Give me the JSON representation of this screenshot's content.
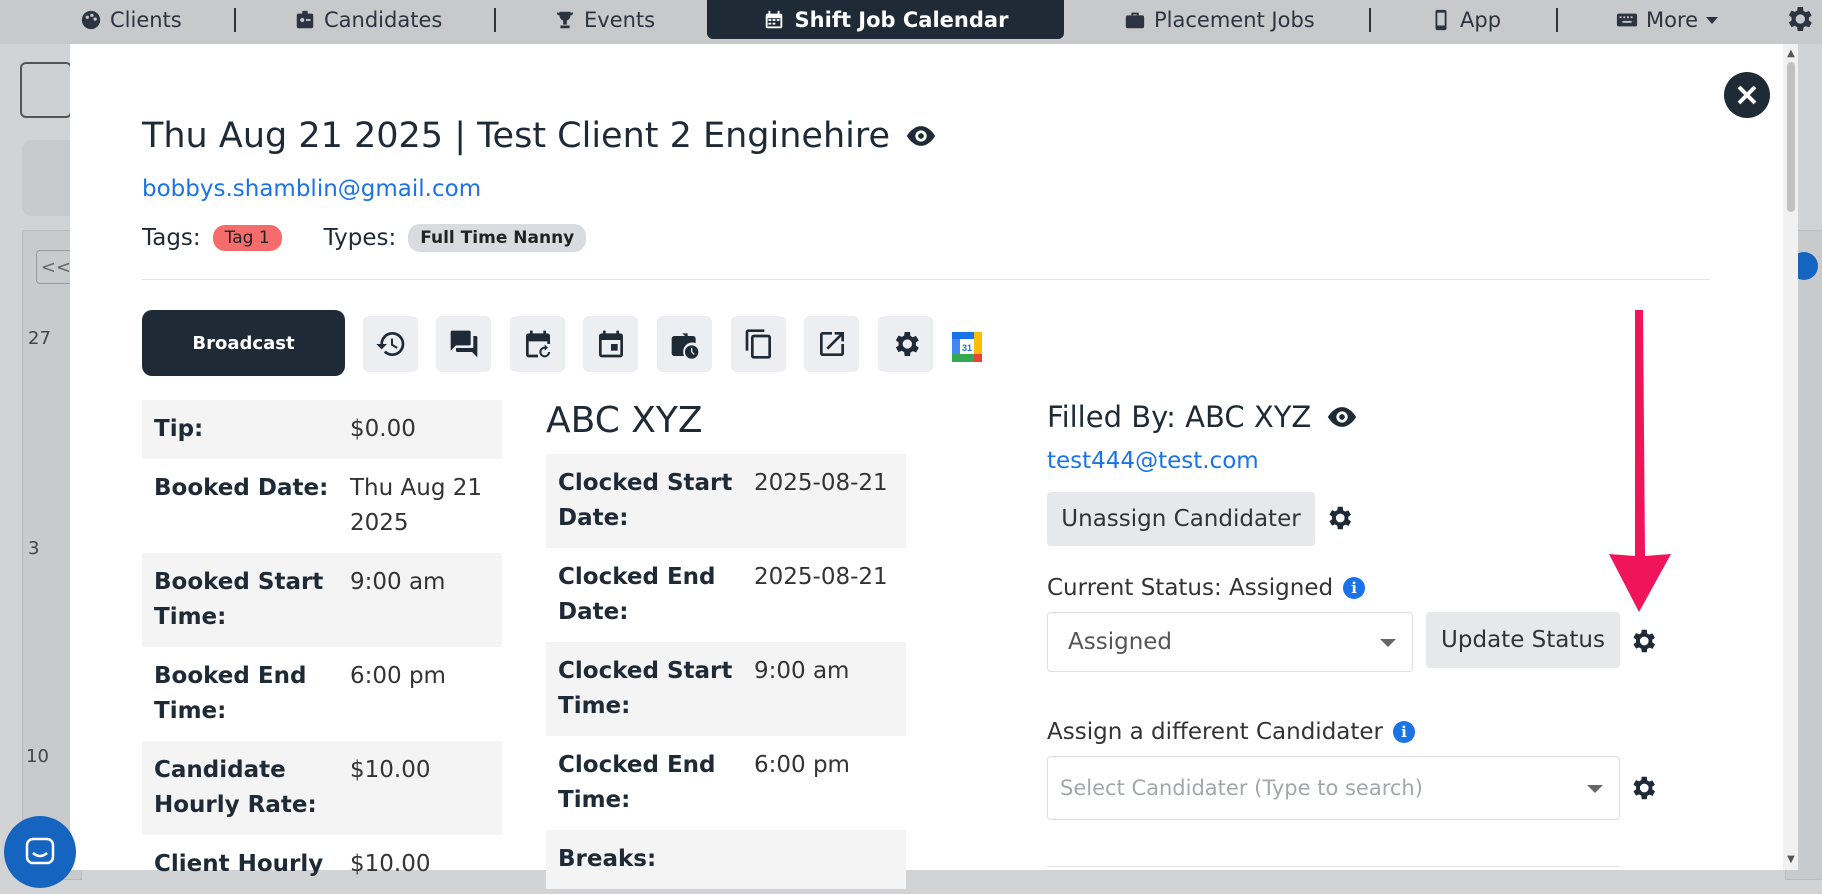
{
  "topnav": {
    "items": [
      {
        "label": "Clients",
        "icon": "palette-icon"
      },
      {
        "label": "Candidates",
        "icon": "id-badge-icon"
      },
      {
        "label": "Events",
        "icon": "trophy-icon"
      },
      {
        "label": "Shift Job Calendar",
        "icon": "calendar-icon",
        "active": true
      },
      {
        "label": "Placement Jobs",
        "icon": "briefcase-icon"
      },
      {
        "label": "App",
        "icon": "phone-icon"
      },
      {
        "label": "More",
        "icon": "keyboard-icon"
      }
    ]
  },
  "background": {
    "prev": "<<",
    "days": [
      "27",
      "3",
      "10"
    ]
  },
  "modal": {
    "title": "Thu Aug 21 2025 | Test Client 2 Enginehire",
    "email": "bobbys.shamblin@gmail.com",
    "tags_label": "Tags:",
    "tag": "Tag 1",
    "types_label": "Types:",
    "type": "Full Time Nanny",
    "broadcast_label": "Broadcast",
    "left_table": [
      {
        "key": "Tip:",
        "value": "$0.00"
      },
      {
        "key": "Booked Date:",
        "value": "Thu Aug 21 2025"
      },
      {
        "key": "Booked Start Time:",
        "value": "9:00 am"
      },
      {
        "key": "Booked End Time:",
        "value": "6:00 pm"
      },
      {
        "key": "Candidate Hourly Rate:",
        "value": "$10.00"
      },
      {
        "key": "Client Hourly",
        "value": "$10.00"
      }
    ],
    "candidate_name": "ABC XYZ",
    "mid_table": [
      {
        "key": "Clocked Start Date:",
        "value": "2025-08-21"
      },
      {
        "key": "Clocked End Date:",
        "value": "2025-08-21"
      },
      {
        "key": "Clocked Start Time:",
        "value": "9:00 am"
      },
      {
        "key": "Clocked End Time:",
        "value": "6:00 pm"
      },
      {
        "key": "Breaks:",
        "value": ""
      }
    ],
    "filled_by": "Filled By: ABC XYZ",
    "filled_email": "test444@test.com",
    "unassign_label": "Unassign Candidater",
    "current_status_label": "Current Status: Assigned",
    "status_value": "Assigned",
    "update_status_label": "Update Status",
    "assign_label": "Assign a different Candidater",
    "assign_placeholder": "Select Candidater (Type to search)"
  },
  "colors": {
    "dark": "#1f2a37",
    "link": "#1a73e8",
    "tag": "#f56c6c",
    "arrow": "#f0145a"
  }
}
